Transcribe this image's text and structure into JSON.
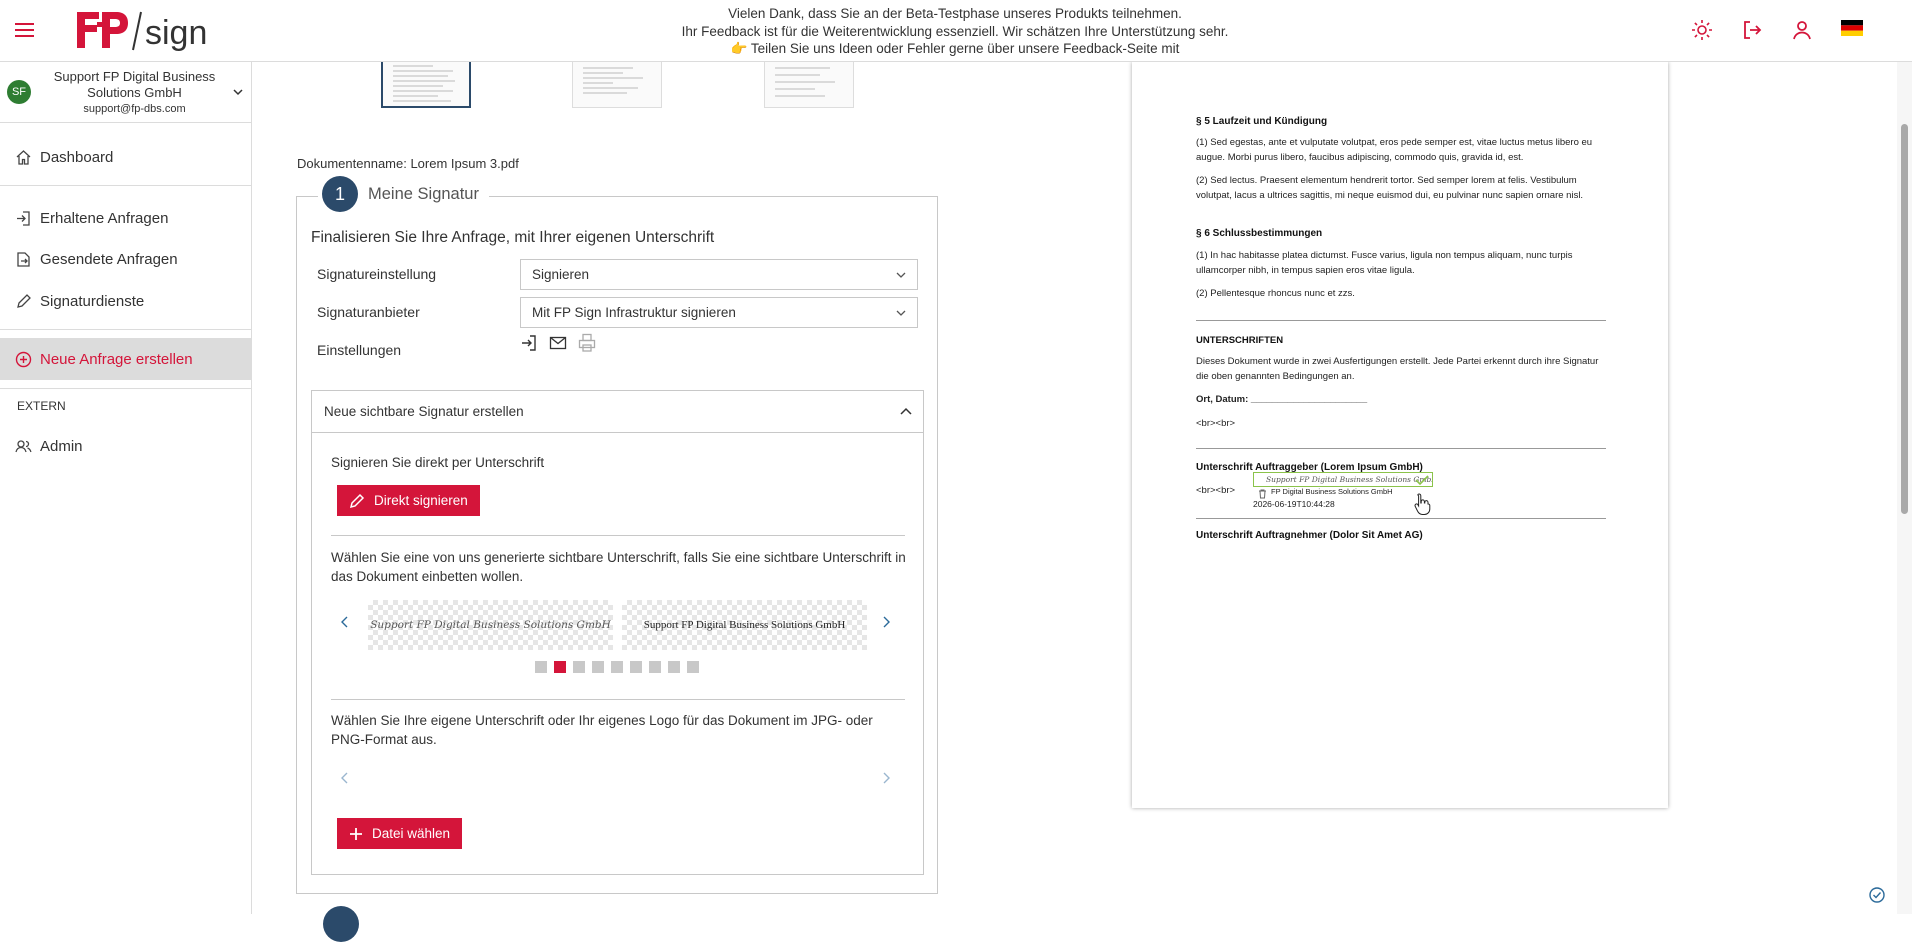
{
  "header": {
    "logo_text": "FP/sign",
    "beta_line1": "Vielen Dank, dass Sie an der Beta-Testphase unseres Produkts teilnehmen.",
    "beta_line2": "Ihr Feedback ist für die Weiterentwicklung essenziell. Wir schätzen Ihre Unterstützung sehr.",
    "beta_line3": "👉 Teilen Sie uns Ideen oder Fehler gerne über unsere Feedback-Seite mit",
    "icons": [
      "menu-icon",
      "theme-sun-icon",
      "logout-icon",
      "user-icon",
      "german-flag-icon"
    ]
  },
  "sidebar": {
    "user": {
      "initials": "SF",
      "name": "Support FP Digital Business Solutions GmbH",
      "email": "support@fp-dbs.com"
    },
    "items": [
      {
        "label": "Dashboard",
        "icon": "home-icon"
      },
      {
        "label": "Erhaltene Anfragen",
        "icon": "inbox-arrow-icon"
      },
      {
        "label": "Gesendete Anfragen",
        "icon": "sent-document-icon"
      },
      {
        "label": "Signaturdienste",
        "icon": "pen-icon"
      },
      {
        "label": "Neue Anfrage erstellen",
        "icon": "plus-circle-icon"
      }
    ],
    "section_extern": "EXTERN",
    "admin": {
      "label": "Admin",
      "icon": "users-icon"
    }
  },
  "main": {
    "document_name": "Dokumentenname: Lorem Ipsum 3.pdf",
    "step_number": "1",
    "step_title": "Meine Signatur",
    "form_title": "Finalisieren Sie Ihre Anfrage, mit Ihrer eigenen Unterschrift",
    "label_signature_setting": "Signatureinstellung",
    "value_signature_setting": "Signieren",
    "label_provider": "Signaturanbieter",
    "value_provider": "Mit FP Sign Infrastruktur signieren",
    "label_settings": "Einstellungen",
    "panel": {
      "title": "Neue sichtbare Signatur erstellen",
      "direct_text": "Signieren Sie direkt per Unterschrift",
      "direct_button": "Direkt signieren",
      "generated_text": "Wählen Sie eine von uns generierte sichtbare Unterschrift, falls Sie eine sichtbare Unterschrift in das Dokument einbetten wollen.",
      "signature_samples": [
        "Support FP Digital Business Solutions GmbH",
        "Support FP Digital Business Solutions GmbH"
      ],
      "carousel_dots": 9,
      "active_dot": 2,
      "upload_text": "Wählen Sie Ihre eigene Unterschrift oder Ihr eigenes Logo für das Dokument im JPG- oder PNG-Format aus.",
      "upload_button": "Datei wählen"
    }
  },
  "document": {
    "h_laufzeit": "§ 5 Laufzeit und Kündigung",
    "p1": "(1) Sed egestas, ante et vulputate volutpat, eros pede semper est, vitae luctus metus libero eu augue. Morbi purus libero, faucibus adipiscing, commodo quis, gravida id, est.",
    "p2": "(2) Sed lectus. Praesent elementum hendrerit tortor. Sed semper lorem at felis. Vestibulum volutpat, lacus a ultrices sagittis, mi neque euismod dui, eu pulvinar nunc sapien ornare nisl.",
    "h_schluss": "§ 6 Schlussbestimmungen",
    "p3": "(1) In hac habitasse platea dictumst. Fusce varius, ligula non tempus aliquam, nunc turpis ullamcorper nibh, in tempus sapien eros vitae ligula.",
    "p4": "(2) Pellentesque rhoncus nunc et zzs.",
    "h_unterschriften": "UNTERSCHRIFTEN",
    "p5": "Dieses Dokument wurde in zwei Ausfertigungen erstellt. Jede Partei erkennt durch ihre Signatur die oben genannten Bedingungen an.",
    "ort_datum": "Ort, Datum: ______________________",
    "br1": "<br><br>",
    "h_auftraggeber": "Unterschrift Auftraggeber (Lorem Ipsum GmbH)",
    "br2": "<br><br>",
    "stamp_sig": "Support FP Digital Business Solutions GmbH",
    "stamp_line1": "FP Digital Business Solutions GmbH",
    "stamp_line2": "2026-06-19T10:44:28",
    "stamp_prefix": "S",
    "h_auftragnehmer": "Unterschrift Auftragnehmer (Dolor Sit Amet AG)"
  },
  "colors": {
    "brand_red": "#d4153a",
    "step_navy": "#2b4a6a",
    "avatar_green": "#2e7d32"
  }
}
